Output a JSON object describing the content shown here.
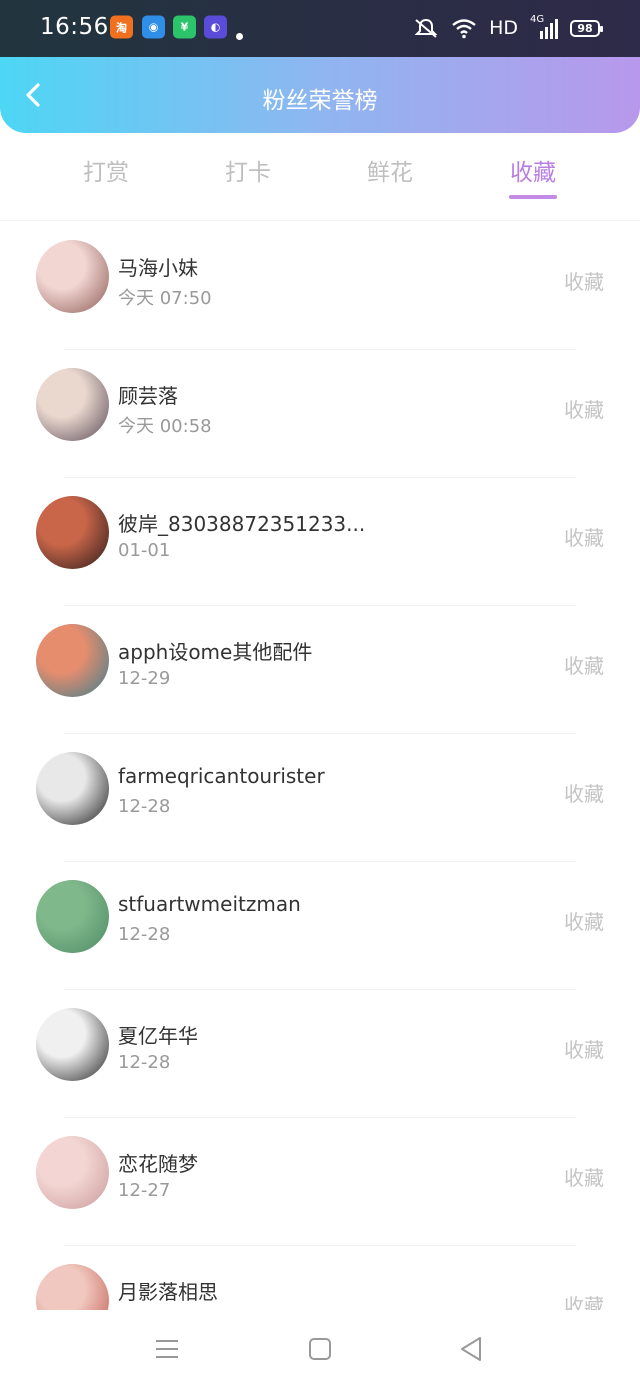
{
  "status_bar": {
    "time": "16:56",
    "apps": [
      {
        "icon": "taobao-icon",
        "glyph": "淘",
        "color": "#f07020"
      },
      {
        "icon": "browser-icon",
        "glyph": "◉",
        "color": "#2f8fe8"
      },
      {
        "icon": "wallet-icon",
        "glyph": "¥",
        "color": "#2cc46b"
      },
      {
        "icon": "camera-app-icon",
        "glyph": "◐",
        "color": "#5a4bd8"
      }
    ],
    "network": "HD",
    "signal": "4G",
    "battery": "98"
  },
  "header": {
    "title": "粉丝荣誉榜"
  },
  "tabs": [
    {
      "label": "打赏",
      "active": false
    },
    {
      "label": "打卡",
      "active": false
    },
    {
      "label": "鲜花",
      "active": false
    },
    {
      "label": "收藏",
      "active": true
    }
  ],
  "fans": [
    {
      "name": "马海小妹",
      "date": "今天 07:50",
      "action": "收藏",
      "avatar_colors": [
        "#f2d6d2",
        "#8c5a55"
      ]
    },
    {
      "name": "顾芸落",
      "date": "今天 00:58",
      "action": "收藏",
      "avatar_colors": [
        "#ead8cf",
        "#5a4a55"
      ]
    },
    {
      "name": "彼岸_83038872351233...",
      "date": "01-01",
      "action": "收藏",
      "avatar_colors": [
        "#c9664a",
        "#2a1a1a"
      ]
    },
    {
      "name": "apph设ome其他配件",
      "date": "12-29",
      "action": "收藏",
      "avatar_colors": [
        "#e68d6e",
        "#3b7e8e"
      ]
    },
    {
      "name": "farmeqricantourister",
      "date": "12-28",
      "action": "收藏",
      "avatar_colors": [
        "#e8e8e8",
        "#1a1a1a"
      ]
    },
    {
      "name": "stfuartwmeitzman",
      "date": "12-28",
      "action": "收藏",
      "avatar_colors": [
        "#7fb88b",
        "#4d8a63"
      ]
    },
    {
      "name": "夏亿年华",
      "date": "12-28",
      "action": "收藏",
      "avatar_colors": [
        "#f0f0f0",
        "#222222"
      ]
    },
    {
      "name": "恋花随梦",
      "date": "12-27",
      "action": "收藏",
      "avatar_colors": [
        "#f3d6d3",
        "#c89a9a"
      ]
    },
    {
      "name": "月影落相思",
      "date": "",
      "action": "收藏",
      "avatar_colors": [
        "#f0c8bf",
        "#c25a4f"
      ]
    }
  ],
  "nav": [
    {
      "icon": "menu-icon"
    },
    {
      "icon": "home-icon"
    },
    {
      "icon": "back-triangle-icon"
    }
  ]
}
